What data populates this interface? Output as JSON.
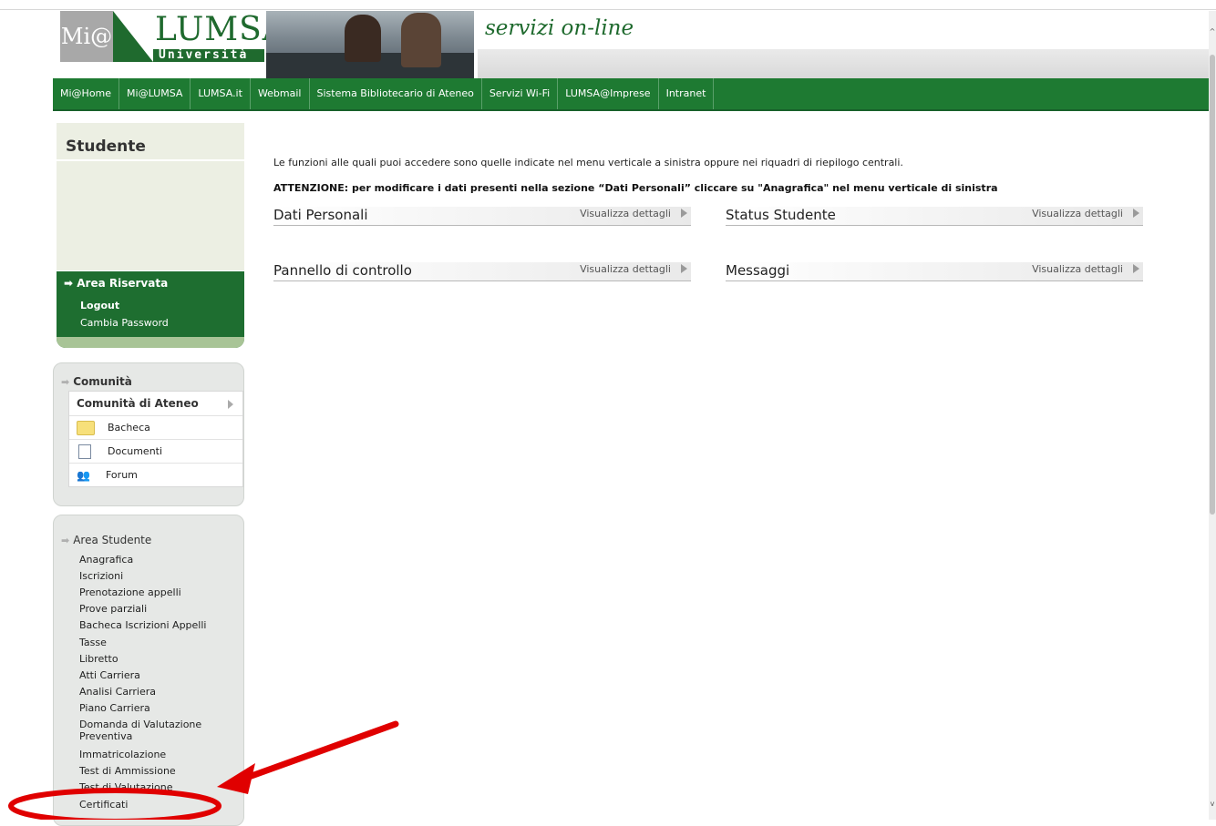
{
  "header": {
    "logo_mi": "Mi@",
    "logo_lumsa": "LUMSA",
    "logo_univ": "Università",
    "servizi": "servizi on-line"
  },
  "topnav": [
    "Mi@Home",
    "Mi@LUMSA",
    "LUMSA.it",
    "Webmail",
    "Sistema Bibliotecario di Ateneo",
    "Servizi Wi-Fi",
    "LUMSA@Imprese",
    "Intranet"
  ],
  "sidebar": {
    "student_title": "Studente",
    "area_riservata": {
      "title": "Area Riservata",
      "links": [
        "Logout",
        "Cambia Password"
      ]
    },
    "comunita": {
      "title": "Comunità",
      "head": "Comunità di Ateneo",
      "items": [
        "Bacheca",
        "Documenti",
        "Forum"
      ]
    },
    "area_studente": {
      "title": "Area Studente",
      "links": [
        "Anagrafica",
        "Iscrizioni",
        "Prenotazione appelli",
        "Prove parziali",
        "Bacheca Iscrizioni Appelli",
        "Tasse",
        "Libretto",
        "Atti Carriera",
        "Analisi Carriera",
        "Piano Carriera",
        "Domanda di Valutazione Preventiva",
        "Immatricolazione",
        "Test di Ammissione",
        "Test di Valutazione",
        "Certificati"
      ]
    }
  },
  "main": {
    "intro": "Le funzioni alle quali puoi accedere sono quelle indicate nel menu verticale a sinistra oppure nei riquadri di riepilogo centrali.",
    "warning": "ATTENZIONE: per modificare i dati presenti nella sezione “Dati Personali” cliccare su \"Anagrafica\" nel menu verticale di sinistra",
    "details_label": "Visualizza dettagli",
    "sections": [
      "Dati Personali",
      "Status Studente",
      "Pannello di controllo",
      "Messaggi"
    ]
  },
  "colors": {
    "brand_green": "#1e7a32",
    "annotation_red": "#e00000"
  },
  "icons": [
    "arrow-right-icon",
    "folder-icon",
    "document-icon",
    "people-icon",
    "triangle-right-icon"
  ]
}
